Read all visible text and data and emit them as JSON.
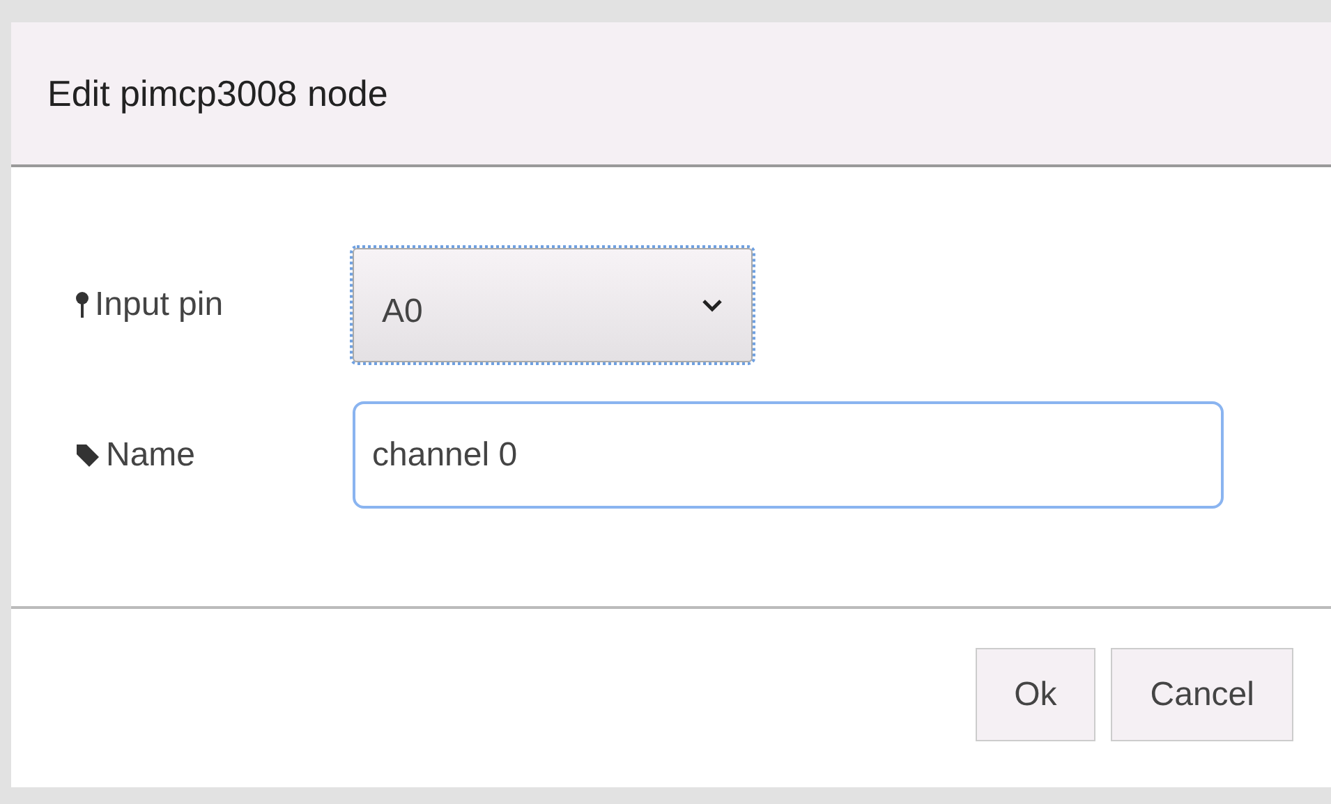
{
  "dialog": {
    "title": "Edit pimcp3008 node"
  },
  "fields": [
    {
      "kind": "select",
      "label": "Input pin",
      "value": "A0"
    },
    {
      "kind": "text",
      "label": "Name",
      "value": "channel 0"
    }
  ],
  "buttons": [
    "Ok",
    "Cancel"
  ]
}
